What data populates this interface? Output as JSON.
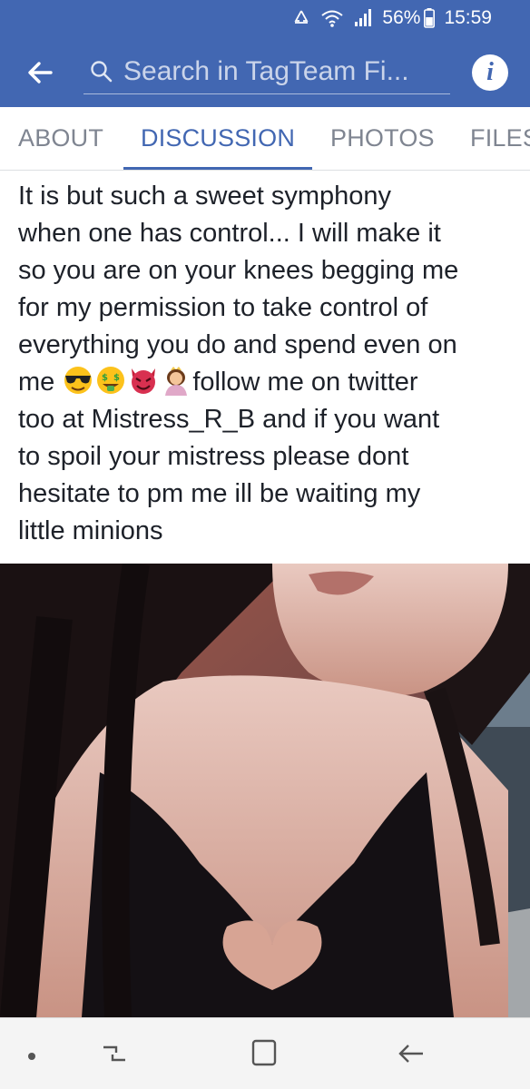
{
  "status_bar": {
    "battery_percent": "56%",
    "time": "15:59",
    "icons": [
      "recycle-icon",
      "wifi-icon",
      "signal-icon",
      "battery-icon"
    ]
  },
  "topbar": {
    "search_placeholder": "Search in TagTeam Fi...",
    "icons": [
      "back-arrow-icon",
      "search-icon",
      "info-icon"
    ]
  },
  "tabs": [
    {
      "label": "ABOUT",
      "active": false
    },
    {
      "label": "DISCUSSION",
      "active": true
    },
    {
      "label": "PHOTOS",
      "active": false
    },
    {
      "label": "FILES",
      "active": false
    }
  ],
  "post": {
    "text_before_emoji": "It is but such a sweet symphony\nwhen one has control... I will make it\nso you are on your knees begging me\nfor my permission to take control of\neverything you do and spend even on\nme ",
    "emojis": [
      "sunglasses-emoji",
      "money-mouth-emoji",
      "devil-emoji",
      "princess-emoji"
    ],
    "text_after_emoji": "follow me on twitter\ntoo at Mistress_R_B and if you want\nto spoil your mistress please dont\nhesitate to pm me ill be waiting my\nlittle minions"
  },
  "navbar": {
    "icons": [
      "dot-icon",
      "recent-apps-icon",
      "home-icon",
      "back-icon"
    ]
  },
  "colors": {
    "brand_blue": "#4267b2",
    "tab_inactive": "#7f8591",
    "text": "#1d2129"
  }
}
